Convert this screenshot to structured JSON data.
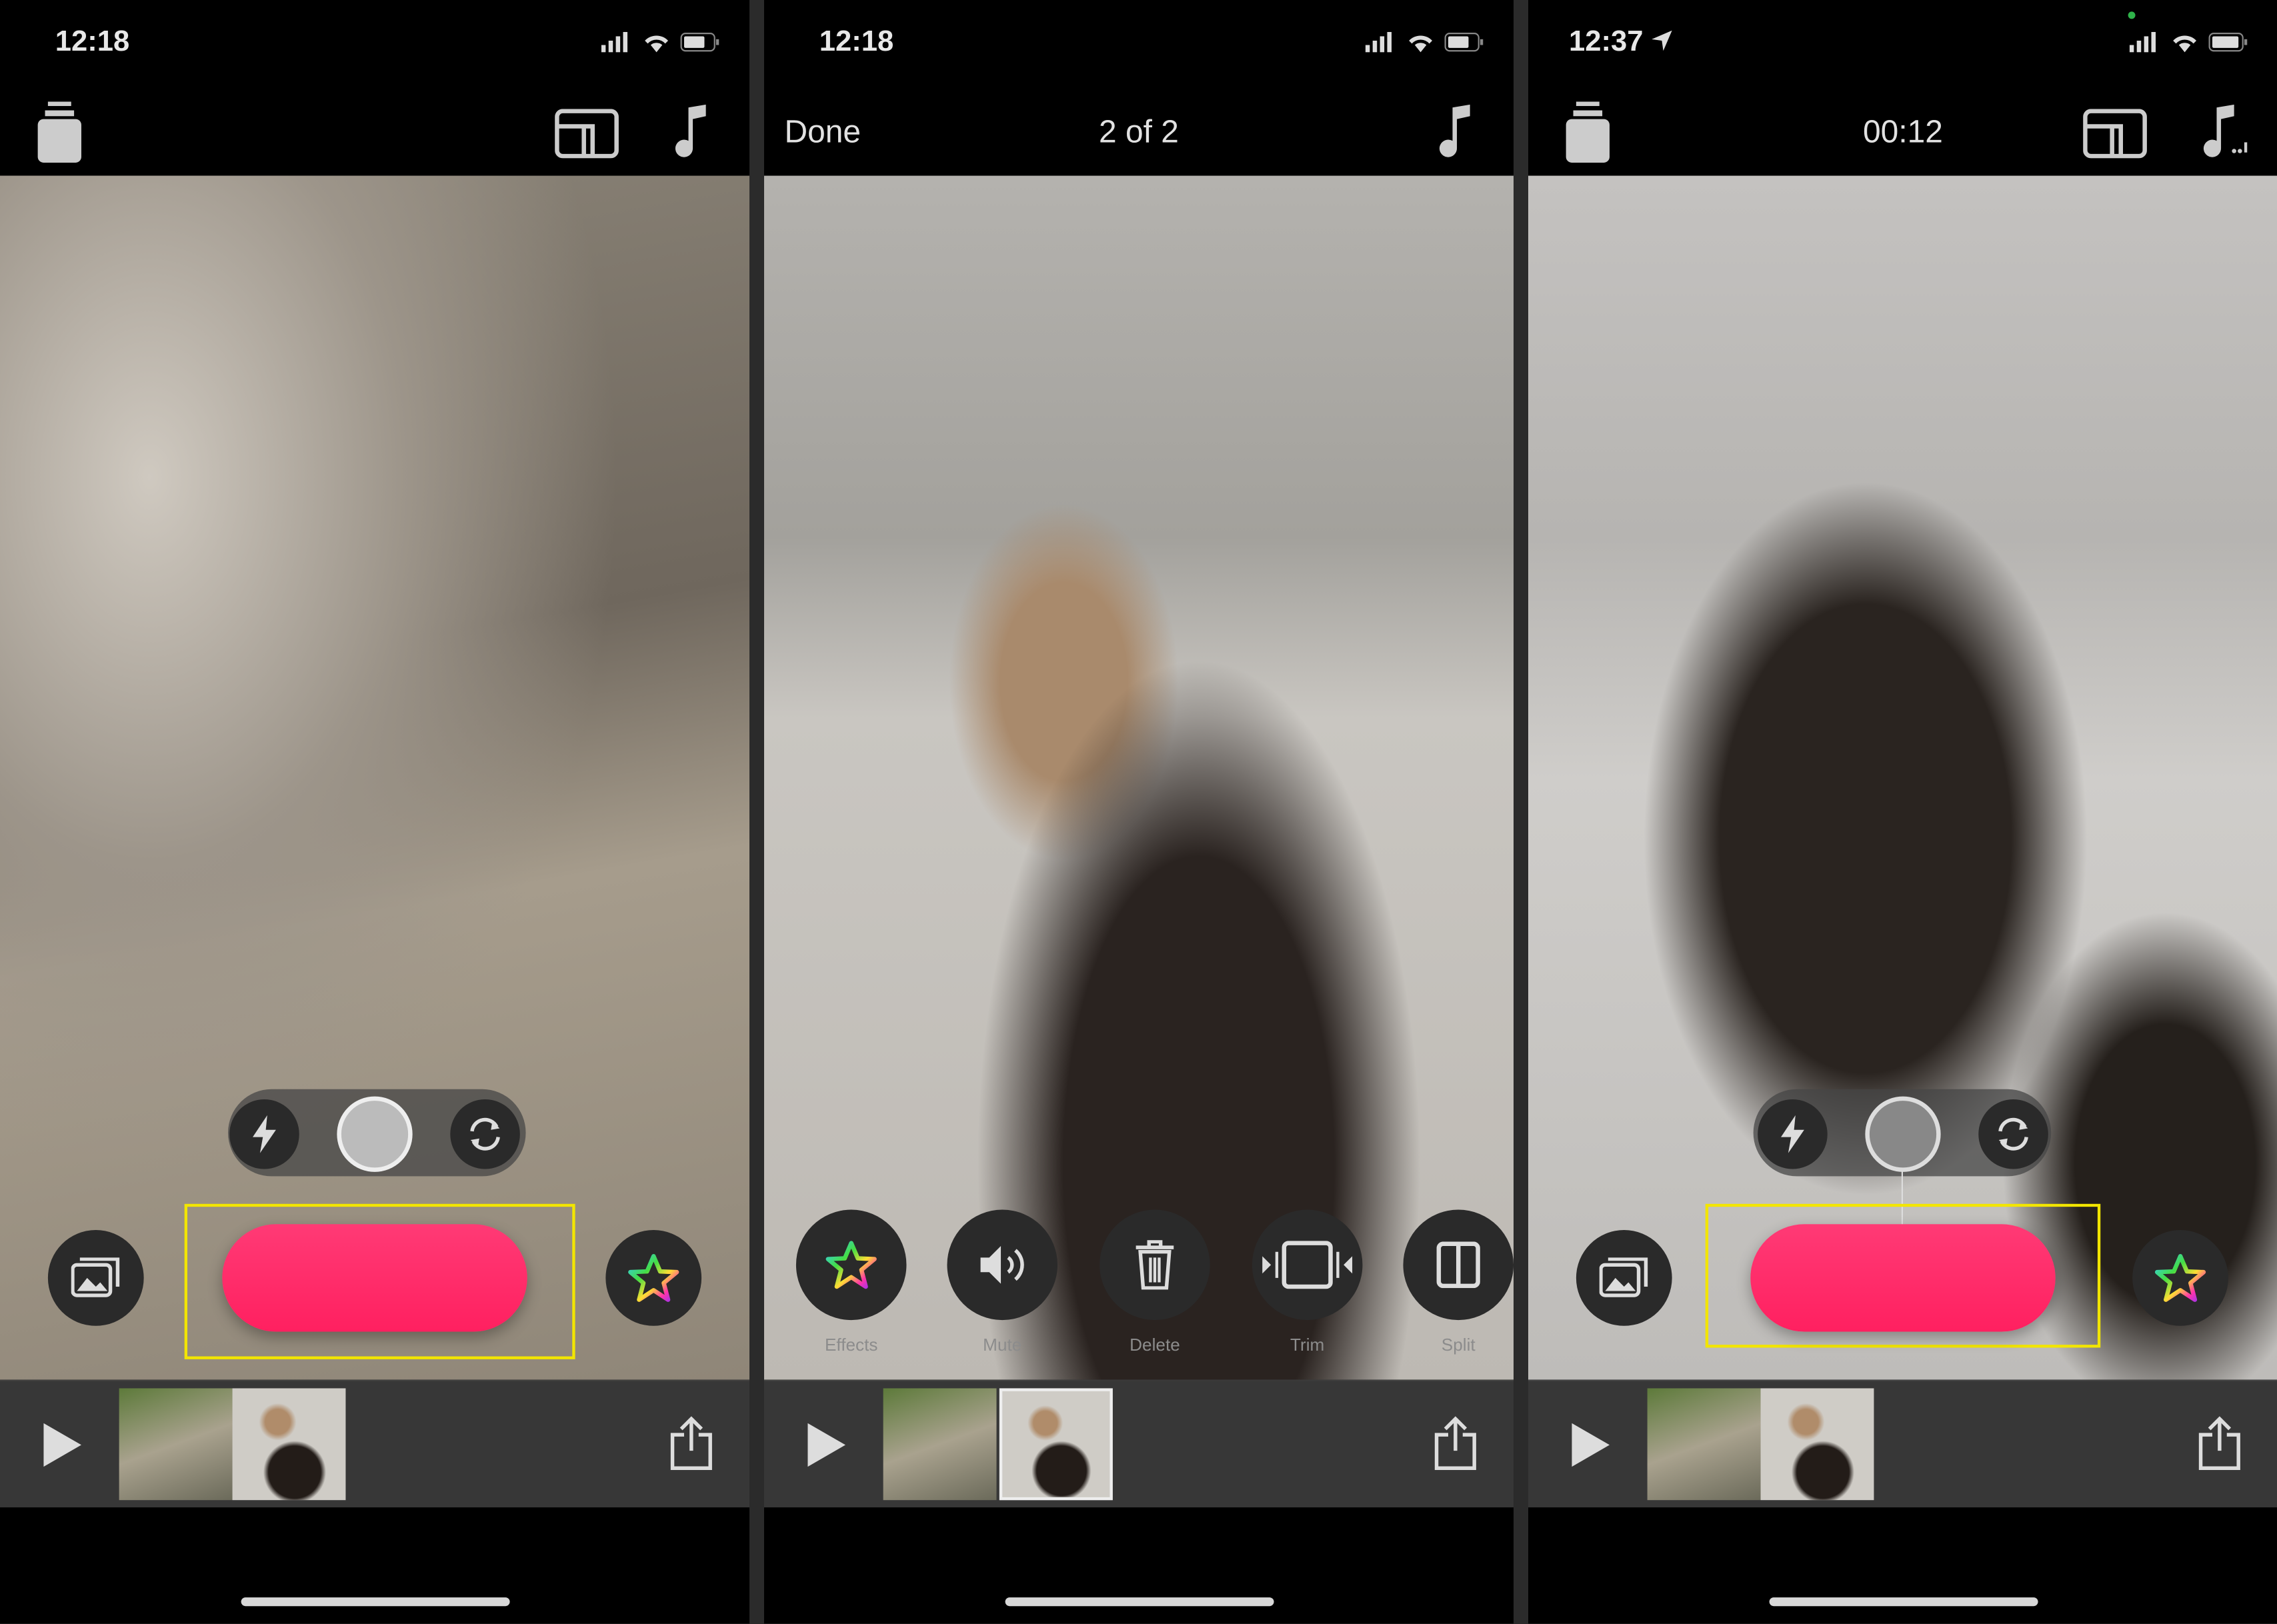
{
  "panels": [
    {
      "status_time": "12:18",
      "header": {
        "layout_icon": "layout-icon",
        "music_icon": "music-note-icon",
        "jar_icon": "jar-icon"
      }
    },
    {
      "status_time": "12:18",
      "header": {
        "done_label": "Done",
        "counter": "2 of 2",
        "music_icon": "music-note-icon"
      },
      "actions": [
        {
          "label": "Effects",
          "icon": "star-icon"
        },
        {
          "label": "Mute",
          "icon": "speaker-icon"
        },
        {
          "label": "Delete",
          "icon": "trash-icon"
        },
        {
          "label": "Trim",
          "icon": "trim-icon"
        },
        {
          "label": "Split",
          "icon": "split-icon"
        }
      ]
    },
    {
      "status_time": "12:37",
      "header": {
        "timer": "00:12",
        "layout_icon": "layout-icon",
        "music_icon": "music-note-icon"
      }
    }
  ],
  "colors": {
    "record": "#ff2d6a",
    "highlight": "#f2e500",
    "background": "#000000"
  }
}
